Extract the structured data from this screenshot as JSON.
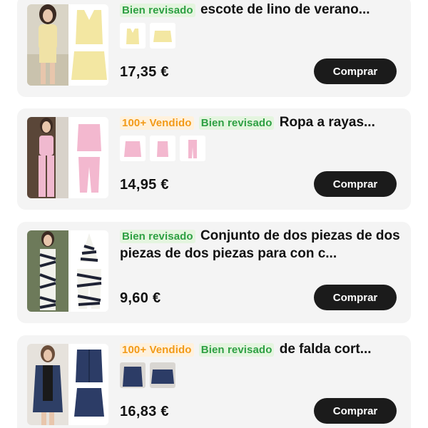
{
  "products": [
    {
      "badges": [
        {
          "type": "review",
          "label": "Bien revisado"
        }
      ],
      "title": "escote de lino de verano...",
      "price": "17,35 €",
      "buy_label": "Comprar"
    },
    {
      "badges": [
        {
          "type": "sold",
          "label": "100+ Vendido"
        },
        {
          "type": "review",
          "label": "Bien revisado"
        }
      ],
      "title": "Ropa a rayas...",
      "price": "14,95 €",
      "buy_label": "Comprar"
    },
    {
      "badges": [
        {
          "type": "review",
          "label": "Bien revisado"
        }
      ],
      "title": "Conjunto de dos piezas de dos piezas de dos piezas para con c...",
      "price": "9,60 €",
      "buy_label": "Comprar"
    },
    {
      "badges": [
        {
          "type": "sold",
          "label": "100+ Vendido"
        },
        {
          "type": "review",
          "label": "Bien revisado"
        }
      ],
      "title": "de falda cort...",
      "price": "16,83 €",
      "buy_label": "Comprar"
    }
  ],
  "colors": {
    "review_green": "#2ea043",
    "sold_orange": "#f29a18",
    "button_dark": "#1b1b1b",
    "card_bg": "#f4f4f4"
  }
}
